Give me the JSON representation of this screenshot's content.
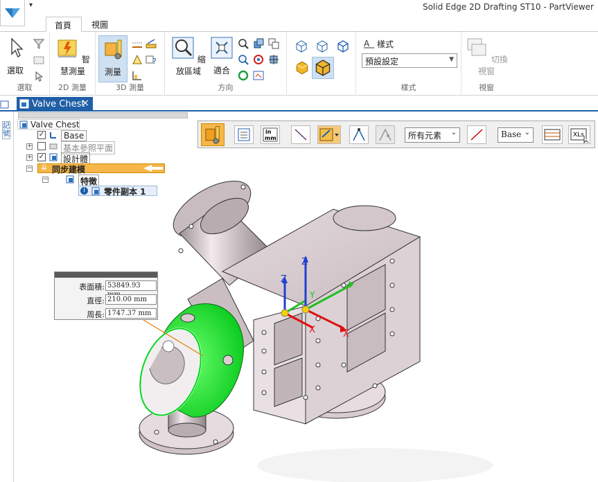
{
  "window": {
    "title": "Solid Edge 2D Drafting ST10 - PartViewer",
    "qat_arrow": "▾"
  },
  "ribbon_tabs": [
    {
      "label": "首頁",
      "active": true
    },
    {
      "label": "視圖",
      "active": false
    }
  ],
  "ribbon": {
    "groups": {
      "select": {
        "label": "選取",
        "button": "選取"
      },
      "measure2d": {
        "label": "2D 測量",
        "button": "智慧測量"
      },
      "measure3d": {
        "label": "3D 測量",
        "button": "測量"
      },
      "orient": {
        "label": "方向",
        "zoom_area": "縮放區域",
        "fit": "適合"
      },
      "styles": {
        "label": "樣式",
        "style_title": "樣式",
        "style_value": "預設設定"
      },
      "window": {
        "label": "視窗",
        "switch": "切換視窗"
      }
    }
  },
  "document": {
    "tab_label": "Valve Chest",
    "close": "×"
  },
  "side_strip": {
    "label": "記號"
  },
  "tree": {
    "root": "Valve Chest",
    "items": [
      {
        "label": "Base",
        "checked": true
      },
      {
        "label": "基本參照平面",
        "checked": false
      },
      {
        "label": "設計體",
        "checked": true
      },
      {
        "label": "同步建模"
      },
      {
        "label": "特徵"
      },
      {
        "label": "零件副本 1"
      }
    ]
  },
  "command_bar": {
    "filter_value": "所有元素",
    "layer_value": "Base",
    "inch_mm": "in\nmm",
    "xl_label": "XLs"
  },
  "measurement": {
    "rows": [
      {
        "label": "表面積:",
        "value": "53849.93 mm"
      },
      {
        "label": "直徑:",
        "value": "210.00 mm"
      },
      {
        "label": "周長:",
        "value": "1747.37 mm"
      }
    ]
  },
  "axes": {
    "z": "Z",
    "x": "X",
    "y": "Y"
  },
  "colors": {
    "accent": "#1f5fa6",
    "highlight": "#00e11a",
    "orange": "#f5a623",
    "body": "#d9ccd0"
  }
}
